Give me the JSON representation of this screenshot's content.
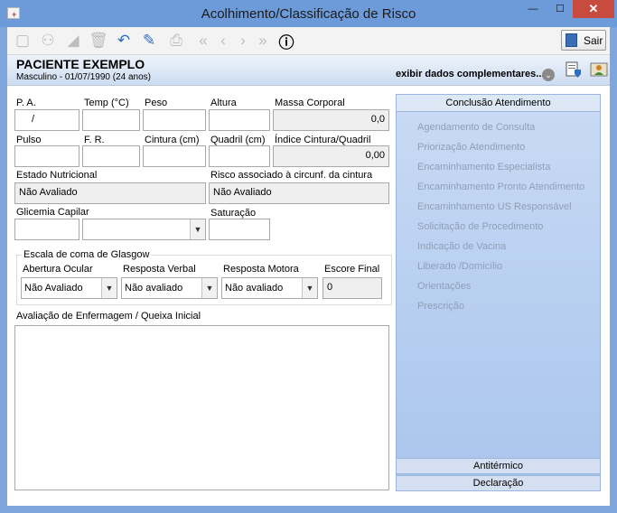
{
  "window": {
    "title": "Acolhimento/Classificação de Risco",
    "minimize": "—",
    "maximize": "☐",
    "close": "✕"
  },
  "toolbar": {
    "exit_label": "Sair"
  },
  "patient": {
    "name": "PACIENTE EXEMPLO",
    "info": "Masculino - 01/07/1990 (24 anos)",
    "more": "exibir dados complementares..."
  },
  "vitals": {
    "pa_label": "P. A.",
    "pa_value": "/",
    "temp_label": "Temp (°C)",
    "temp_value": "",
    "peso_label": "Peso",
    "peso_value": "",
    "altura_label": "Altura",
    "altura_value": "",
    "imc_label": "Massa Corporal",
    "imc_value": "0,0",
    "pulso_label": "Pulso",
    "pulso_value": "",
    "fr_label": "F. R.",
    "fr_value": "",
    "cintura_label": "Cintura (cm)",
    "cintura_value": "",
    "quadril_label": "Quadril (cm)",
    "quadril_value": "",
    "icq_label": "Índice Cintura/Quadril",
    "icq_value": "0,00",
    "nutri_label": "Estado Nutricional",
    "nutri_value": "Não Avaliado",
    "risco_label": "Risco associado à circunf. da cintura",
    "risco_value": "Não Avaliado",
    "glicemia_label": "Glicemia Capilar",
    "glicemia_value": "",
    "glicemia_select": "",
    "saturacao_label": "Saturação",
    "saturacao_value": ""
  },
  "glasgow": {
    "title": "Escala de coma de Glasgow",
    "ocular_label": "Abertura Ocular",
    "ocular_value": "Não Avaliado",
    "verbal_label": "Resposta Verbal",
    "verbal_value": "Não avaliado",
    "motora_label": "Resposta Motora",
    "motora_value": "Não avaliado",
    "escore_label": "Escore Final",
    "escore_value": "0"
  },
  "avaliacao_label": "Avaliação de Enfermagem / Queixa Inicial",
  "panel": {
    "header": "Conclusão Atendimento",
    "items": [
      "Agendamento de Consulta",
      "Priorização Atendimento",
      "Encaminhamento Especialista",
      "Encaminhamento Pronto Atendimento",
      "Encaminhamento US Responsável",
      "Solicitação de Procedimento",
      "Indicação de Vacina",
      "Liberado /Domicílio",
      "Orientações",
      "Prescrição"
    ],
    "tab_antitermico": "Antitérmico",
    "tab_declaracao": "Declaração"
  }
}
